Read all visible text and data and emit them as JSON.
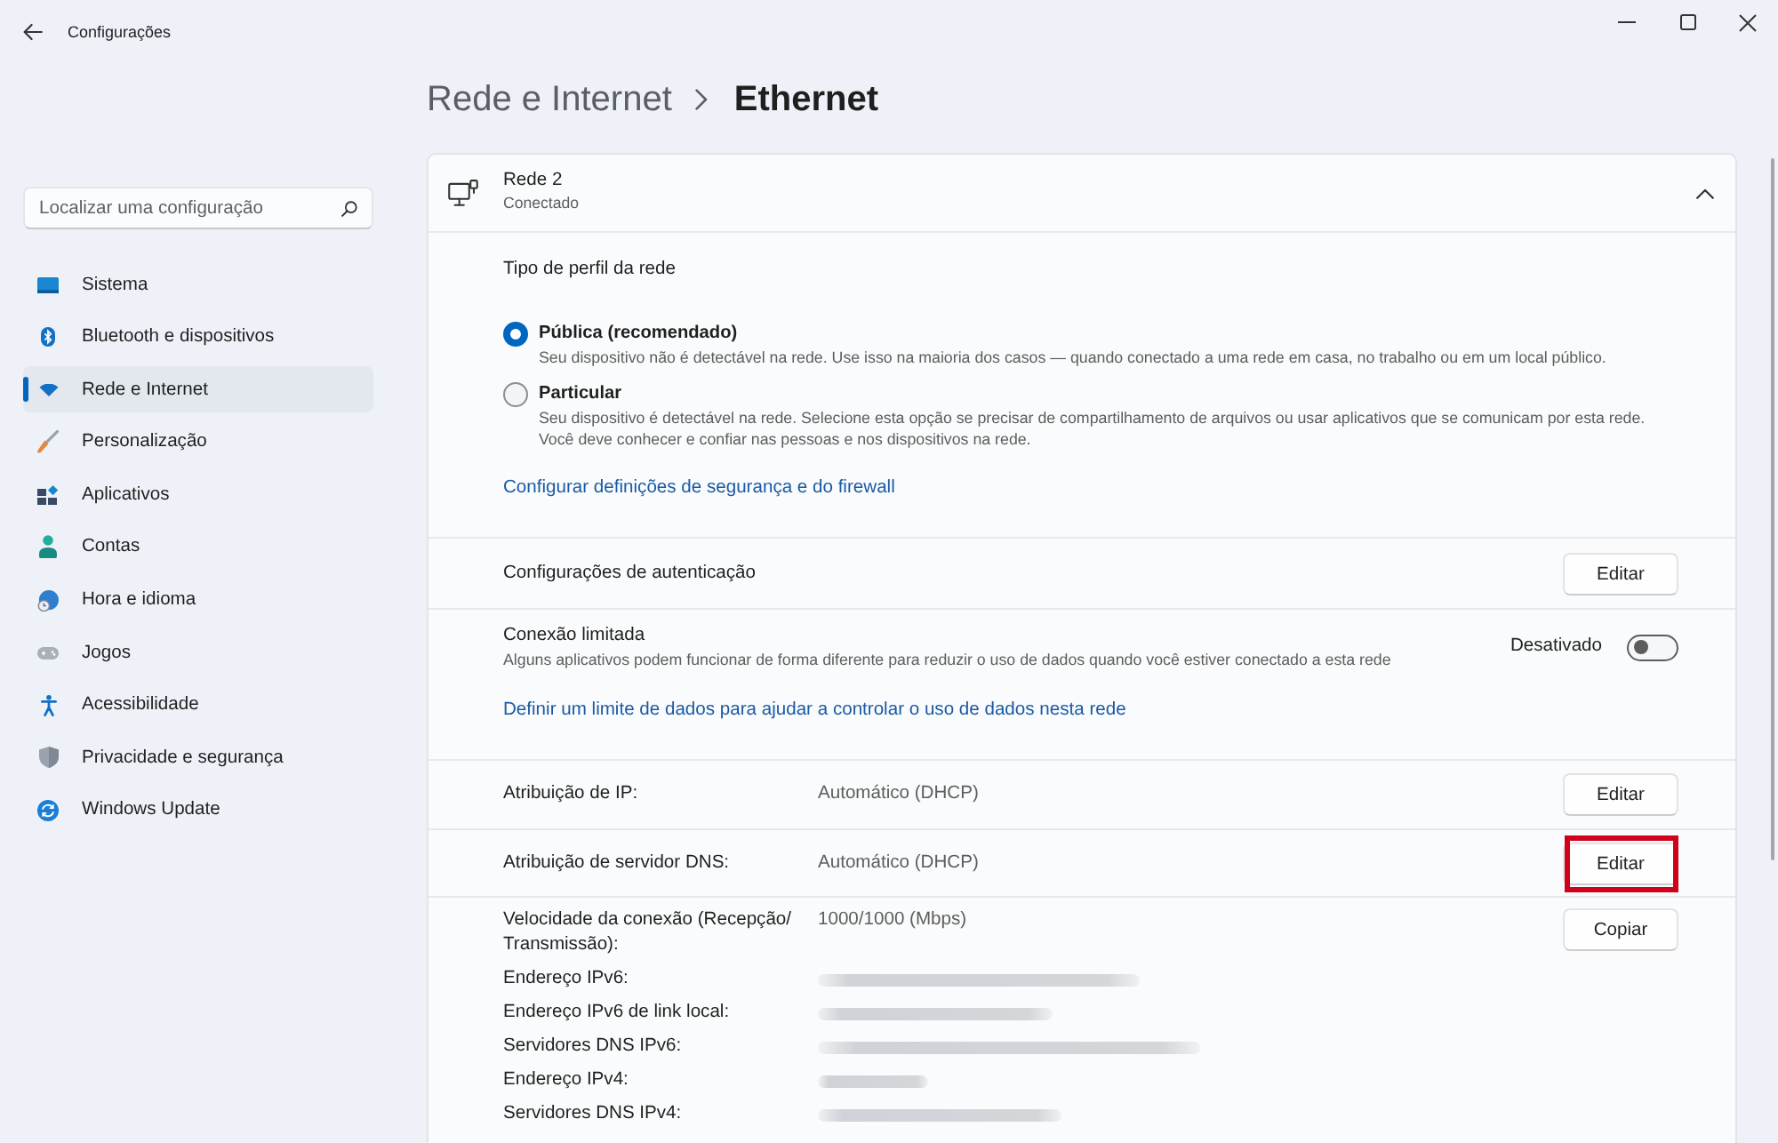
{
  "window": {
    "title": "Configurações"
  },
  "sidebar": {
    "search": {
      "placeholder": "Localizar uma configuração"
    },
    "items": [
      {
        "label": "Sistema",
        "selected": false
      },
      {
        "label": "Bluetooth e dispositivos",
        "selected": false
      },
      {
        "label": "Rede e Internet",
        "selected": true
      },
      {
        "label": "Personalização",
        "selected": false
      },
      {
        "label": "Aplicativos",
        "selected": false
      },
      {
        "label": "Contas",
        "selected": false
      },
      {
        "label": "Hora e idioma",
        "selected": false
      },
      {
        "label": "Jogos",
        "selected": false
      },
      {
        "label": "Acessibilidade",
        "selected": false
      },
      {
        "label": "Privacidade e segurança",
        "selected": false
      },
      {
        "label": "Windows Update",
        "selected": false
      }
    ]
  },
  "breadcrumb": {
    "parent": "Rede e Internet",
    "current": "Ethernet"
  },
  "network": {
    "name": "Rede 2",
    "status": "Conectado",
    "expanded": true
  },
  "profile": {
    "title": "Tipo de perfil da rede",
    "options": [
      {
        "label": "Pública (recomendado)",
        "description": "Seu dispositivo não é detectável na rede. Use isso na maioria dos casos — quando conectado a uma rede em casa, no trabalho ou em um local público.",
        "selected": true
      },
      {
        "label": "Particular",
        "description": "Seu dispositivo é detectável na rede. Selecione esta opção se precisar de compartilhamento de arquivos ou usar aplicativos que se comunicam por esta rede. Você deve conhecer e confiar nas pessoas e nos dispositivos na rede.",
        "selected": false
      }
    ],
    "link": "Configurar definições de segurança e do firewall"
  },
  "authentication": {
    "label": "Configurações de autenticação",
    "button": "Editar"
  },
  "metered": {
    "title": "Conexão limitada",
    "description": "Alguns aplicativos podem funcionar de forma diferente para reduzir o uso de dados quando você estiver conectado a esta rede",
    "state_label": "Desativado",
    "on": false,
    "link": "Definir um limite de dados para ajudar a controlar o uso de dados nesta rede"
  },
  "assignments": [
    {
      "label": "Atribuição de IP:",
      "value": "Automático (DHCP)",
      "button": "Editar",
      "highlighted": false
    },
    {
      "label": "Atribuição de servidor DNS:",
      "value": "Automático (DHCP)",
      "button": "Editar",
      "highlighted": true
    }
  ],
  "properties": {
    "button": "Copiar",
    "rows": [
      {
        "kind": "text",
        "label": "Velocidade da conexão (Recepção/Transmissão):",
        "value": "1000/1000 (Mbps)"
      },
      {
        "kind": "blurred",
        "label": "Endereço IPv6:"
      },
      {
        "kind": "blurred",
        "label": "Endereço IPv6 de link local:"
      },
      {
        "kind": "blurred",
        "label": "Servidores DNS IPv6:"
      },
      {
        "kind": "blurred",
        "label": "Endereço IPv4:"
      },
      {
        "kind": "blurred",
        "label": "Servidores DNS IPv4:"
      }
    ]
  }
}
